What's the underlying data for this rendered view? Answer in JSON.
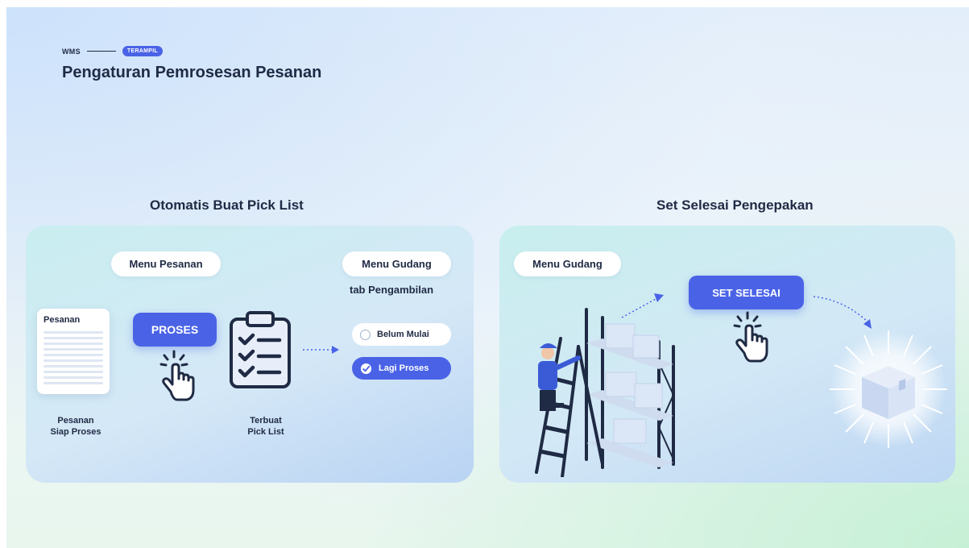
{
  "header": {
    "breadcrumb_root": "WMS",
    "badge": "TERAMPIL",
    "title": "Pengaturan Pemrosesan Pesanan"
  },
  "left_section": {
    "title": "Otomatis Buat Pick List",
    "menu_pesanan": "Menu Pesanan",
    "menu_gudang": "Menu Gudang",
    "tab_label": "tab Pengambilan",
    "doc_title": "Pesanan",
    "doc_caption_line1": "Pesanan",
    "doc_caption_line2": "Siap Proses",
    "proses_button": "PROSES",
    "picklist_caption_line1": "Terbuat",
    "picklist_caption_line2": "Pick List",
    "status_idle": "Belum Mulai",
    "status_active": "Lagi Proses"
  },
  "right_section": {
    "title": "Set Selesai Pengepakan",
    "menu_gudang": "Menu Gudang",
    "set_selesai_button": "SET SELESAI"
  },
  "colors": {
    "accent": "#4a63e6",
    "text": "#1f2a44"
  }
}
